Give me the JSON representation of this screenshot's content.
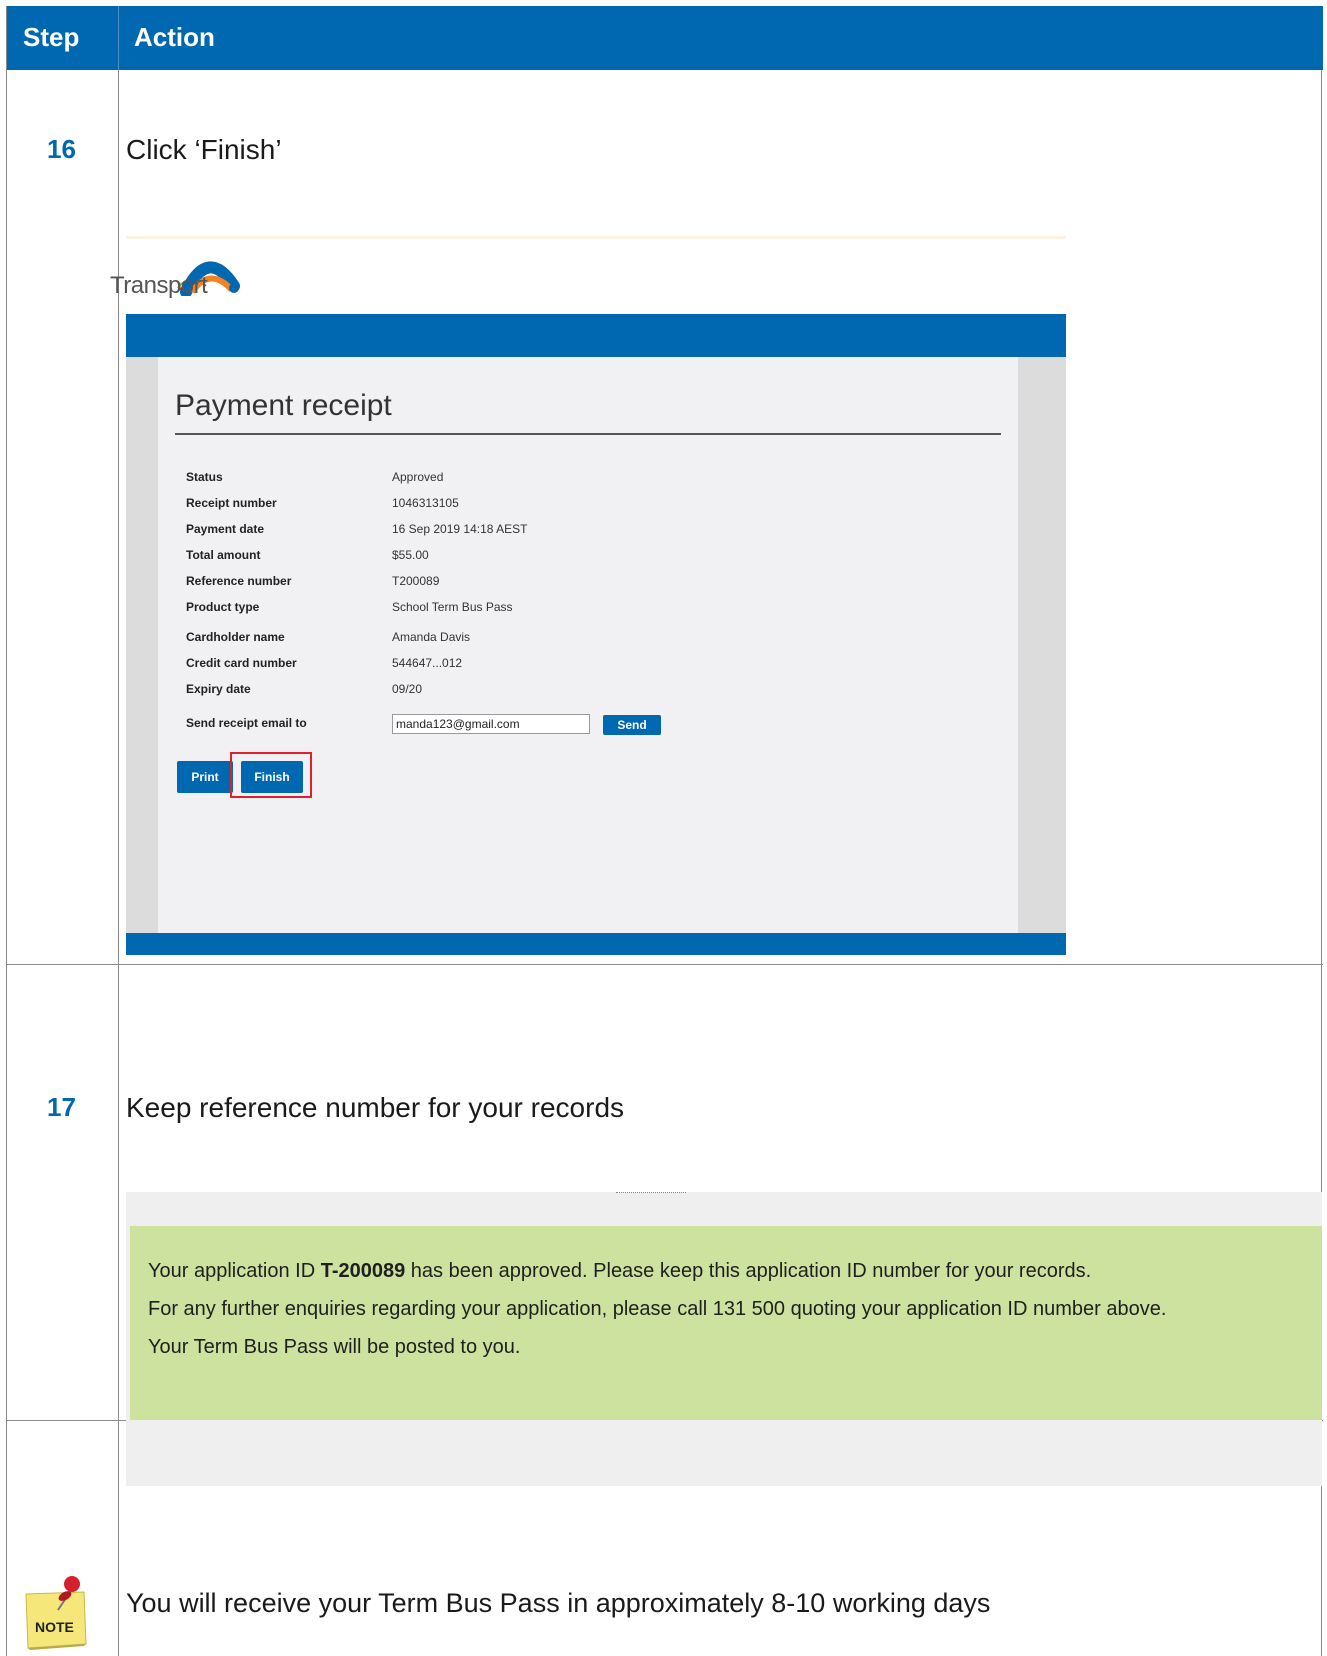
{
  "header": {
    "step": "Step",
    "action": "Action"
  },
  "rows": [
    {
      "step": "16",
      "action": "Click ‘Finish’"
    },
    {
      "step": "17",
      "action": "Keep reference number for your records"
    }
  ],
  "receipt": {
    "logo_text": "Transport",
    "title": "Payment receipt",
    "fields": [
      {
        "label": "Status",
        "value": "Approved"
      },
      {
        "label": "Receipt number",
        "value": "1046313105"
      },
      {
        "label": "Payment date",
        "value": "16 Sep 2019 14:18 AEST"
      },
      {
        "label": "Total amount",
        "value": "$55.00"
      },
      {
        "label": "Reference number",
        "value": "T200089"
      },
      {
        "label": "Product type",
        "value": "School Term Bus Pass"
      },
      {
        "label": "Cardholder name",
        "value": "Amanda Davis"
      },
      {
        "label": "Credit card number",
        "value": "544647...012"
      },
      {
        "label": "Expiry date",
        "value": "09/20"
      }
    ],
    "email_label": "Send receipt email to",
    "email_value": "manda123@gmail.com",
    "send_label": "Send",
    "print_label": "Print",
    "finish_label": "Finish"
  },
  "approval": {
    "line1_prefix": "Your application ID ",
    "line1_id": "T-200089",
    "line1_suffix": " has been approved. Please keep this application ID number for your records.",
    "line2": "For any further enquiries regarding your application, please call 131 500 quoting your application ID number above.",
    "line3": "Your Term Bus Pass will be posted to you."
  },
  "note": {
    "icon_label": "NOTE",
    "text": "You will receive your Term Bus Pass in approximately 8-10 working days"
  },
  "colors": {
    "brand_blue": "#0067b1",
    "approval_green": "#cde29e",
    "highlight_red": "#e0202a"
  }
}
